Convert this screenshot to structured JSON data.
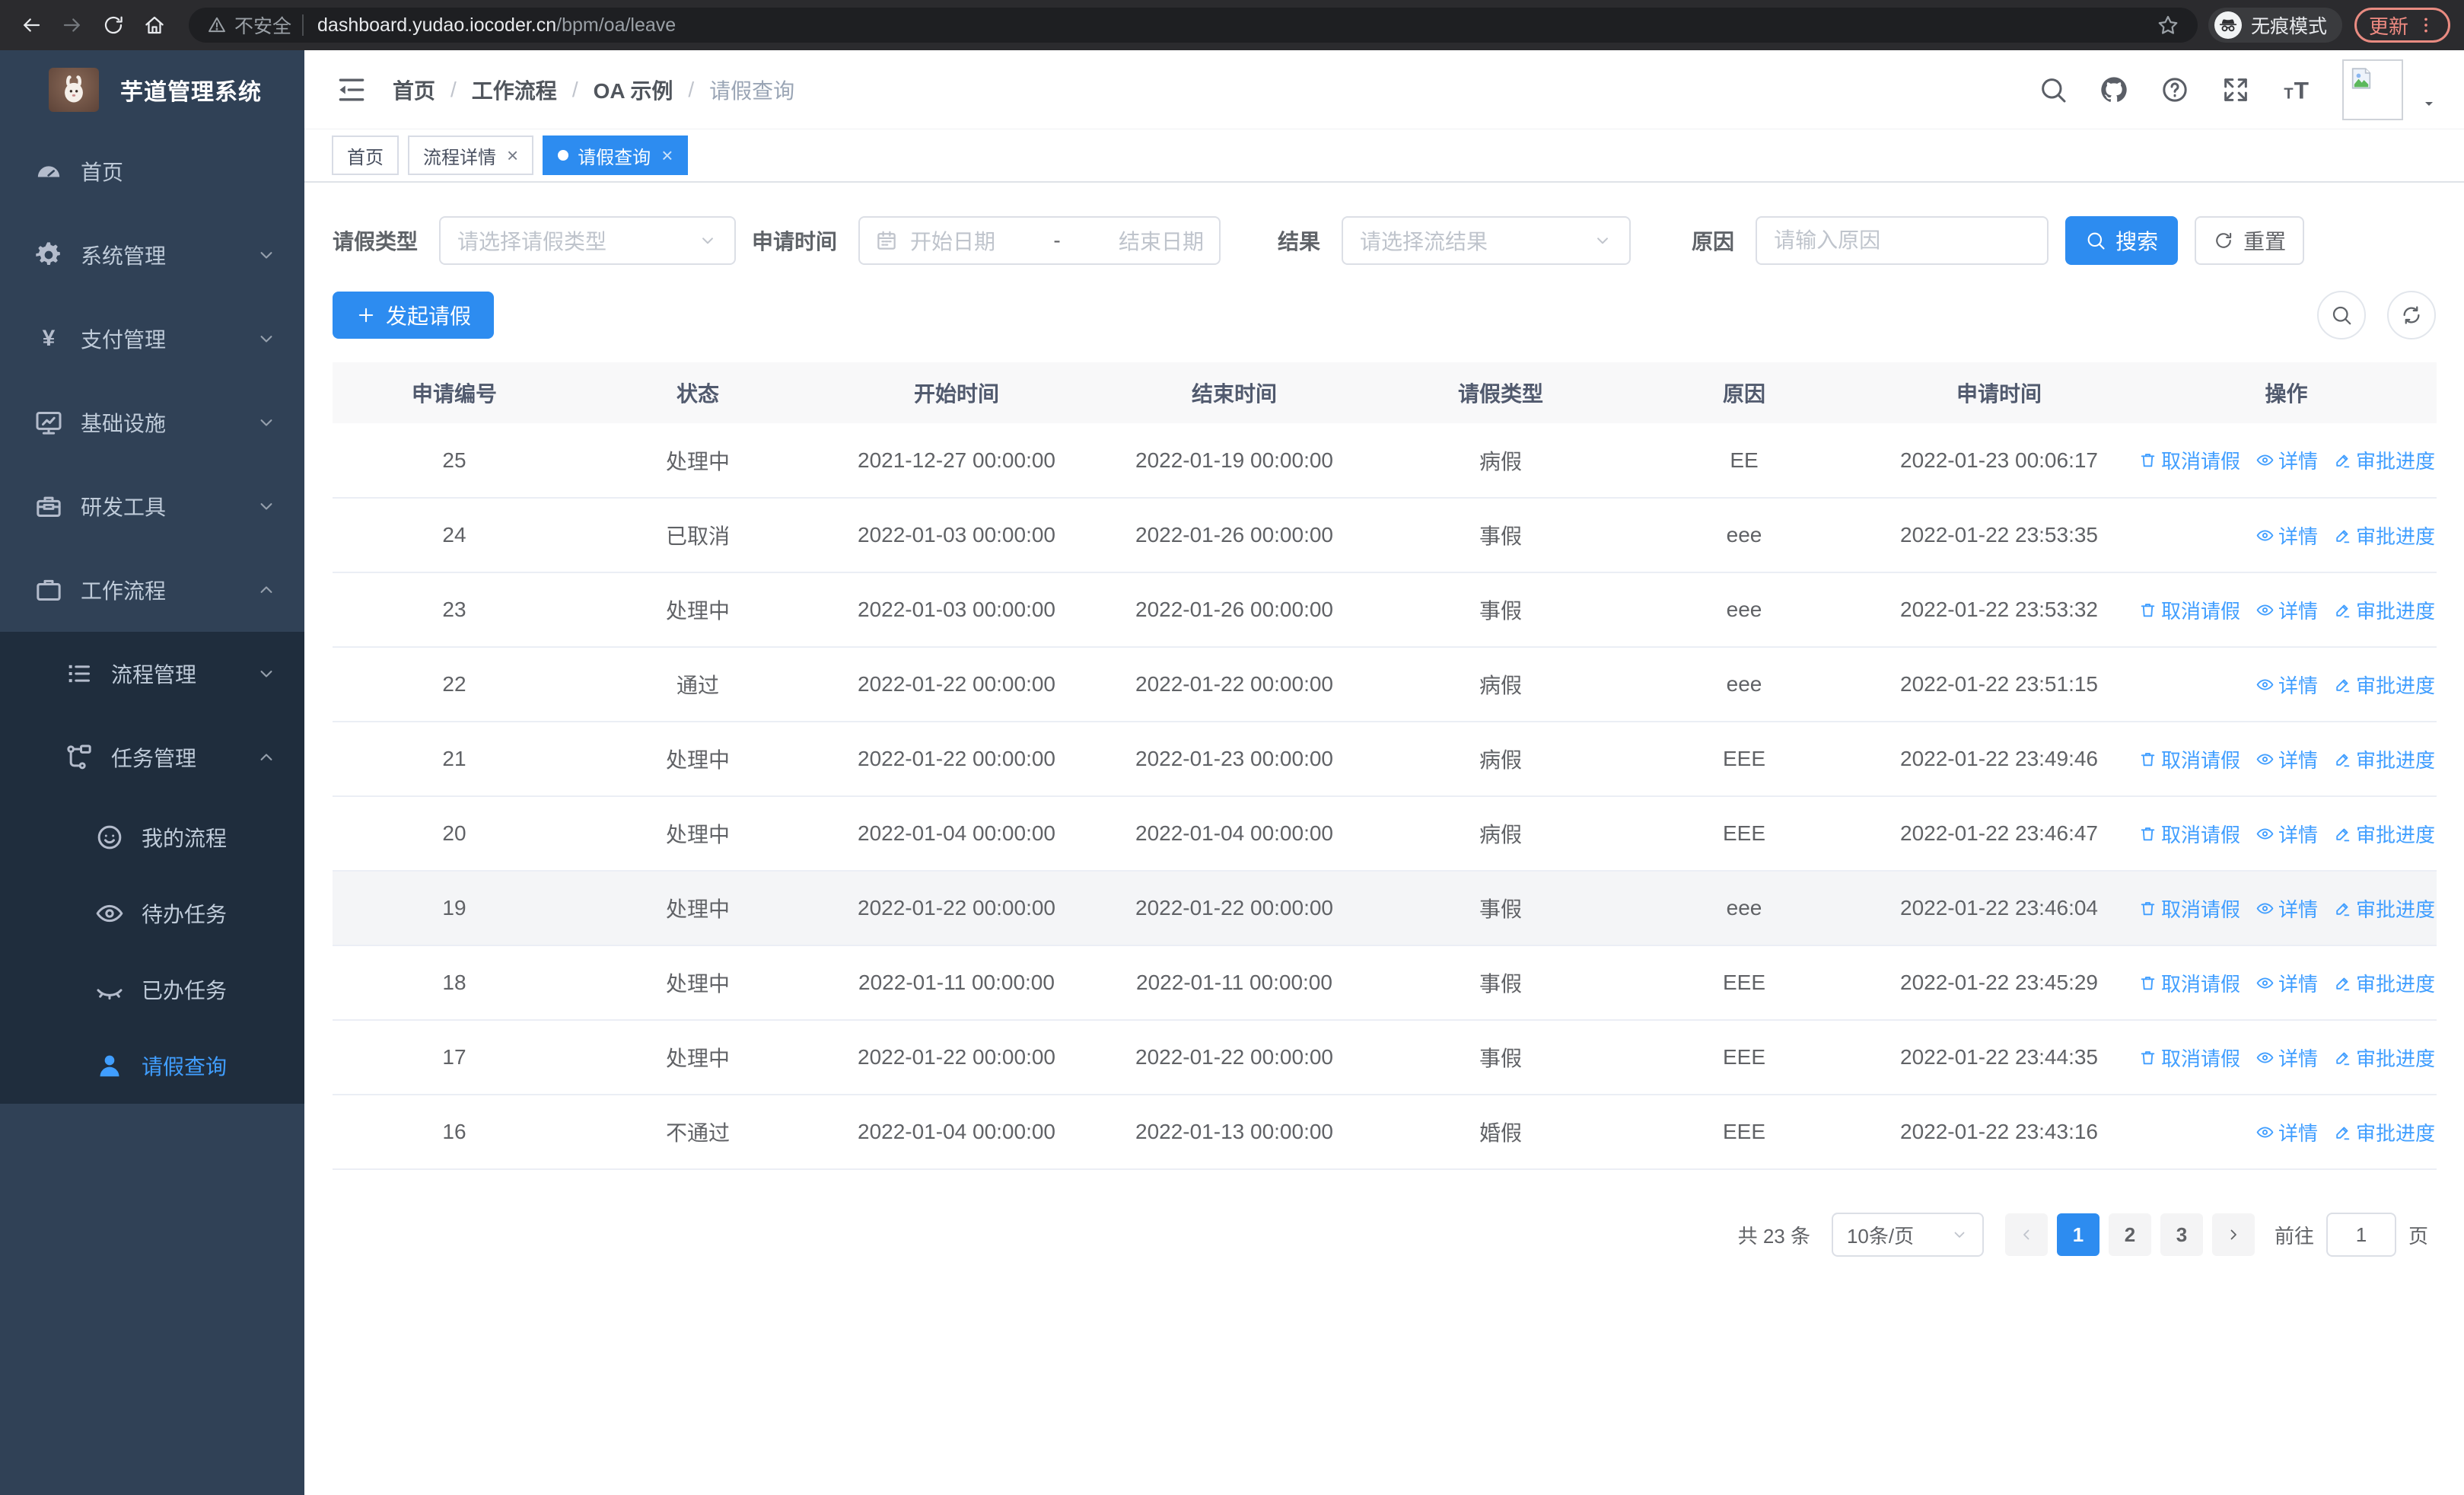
{
  "browser": {
    "security_label": "不安全",
    "url_host": "dashboard.yudao.iocoder.cn",
    "url_path": "/bpm/oa/leave",
    "incognito_label": "无痕模式",
    "update_label": "更新"
  },
  "sidebar": {
    "app_title": "芋道管理系统",
    "menu": [
      {
        "key": "home",
        "icon": "gauge",
        "label": "首页",
        "level": 0
      },
      {
        "key": "system-management",
        "icon": "gear",
        "label": "系统管理",
        "level": 0,
        "chevron": "down"
      },
      {
        "key": "payment-management",
        "icon": "yen",
        "label": "支付管理",
        "level": 0,
        "chevron": "down"
      },
      {
        "key": "infrastructure",
        "icon": "monitor",
        "label": "基础设施",
        "level": 0,
        "chevron": "down"
      },
      {
        "key": "dev-tools",
        "icon": "toolbox",
        "label": "研发工具",
        "level": 0,
        "chevron": "down"
      },
      {
        "key": "workflow",
        "icon": "briefcase",
        "label": "工作流程",
        "level": 0,
        "chevron": "up"
      },
      {
        "key": "process-management",
        "icon": "list",
        "label": "流程管理",
        "level": 1,
        "chevron": "down",
        "sub": true
      },
      {
        "key": "task-management",
        "icon": "flow",
        "label": "任务管理",
        "level": 1,
        "chevron": "up",
        "sub": true
      },
      {
        "key": "my-process",
        "icon": "face",
        "label": "我的流程",
        "level": 2,
        "sub": true
      },
      {
        "key": "todo-tasks",
        "icon": "eye",
        "label": "待办任务",
        "level": 2,
        "sub": true
      },
      {
        "key": "done-tasks",
        "icon": "eyeclosed",
        "label": "已办任务",
        "level": 2,
        "sub": true
      },
      {
        "key": "leave-query",
        "icon": "user",
        "label": "请假查询",
        "level": 2,
        "sub": true,
        "active": true
      }
    ]
  },
  "header": {
    "breadcrumb": [
      "首页",
      "工作流程",
      "OA 示例",
      "请假查询"
    ]
  },
  "tabs": [
    {
      "key": "home",
      "label": "首页",
      "closable": false,
      "active": false
    },
    {
      "key": "process-detail",
      "label": "流程详情",
      "closable": true,
      "active": false
    },
    {
      "key": "leave-query",
      "label": "请假查询",
      "closable": true,
      "active": true
    }
  ],
  "filters": {
    "leave_type": {
      "label": "请假类型",
      "placeholder": "请选择请假类型"
    },
    "apply_time": {
      "label": "申请时间",
      "start_placeholder": "开始日期",
      "separator": "-",
      "end_placeholder": "结束日期"
    },
    "result": {
      "label": "结果",
      "placeholder": "请选择流结果"
    },
    "reason": {
      "label": "原因",
      "placeholder": "请输入原因"
    },
    "search_label": "搜索",
    "reset_label": "重置"
  },
  "toolbar": {
    "create_label": "发起请假"
  },
  "table": {
    "columns": [
      "申请编号",
      "状态",
      "开始时间",
      "结束时间",
      "请假类型",
      "原因",
      "申请时间",
      "操作"
    ],
    "action_labels": {
      "cancel": "取消请假",
      "detail": "详情",
      "progress": "审批进度"
    },
    "rows": [
      {
        "id": "25",
        "status": "处理中",
        "start_time": "2021-12-27 00:00:00",
        "end_time": "2022-01-19 00:00:00",
        "leave_type": "病假",
        "reason": "EE",
        "apply_time": "2022-01-23 00:06:17",
        "actions": [
          "cancel",
          "detail",
          "progress"
        ]
      },
      {
        "id": "24",
        "status": "已取消",
        "start_time": "2022-01-03 00:00:00",
        "end_time": "2022-01-26 00:00:00",
        "leave_type": "事假",
        "reason": "eee",
        "apply_time": "2022-01-22 23:53:35",
        "actions": [
          "detail",
          "progress"
        ]
      },
      {
        "id": "23",
        "status": "处理中",
        "start_time": "2022-01-03 00:00:00",
        "end_time": "2022-01-26 00:00:00",
        "leave_type": "事假",
        "reason": "eee",
        "apply_time": "2022-01-22 23:53:32",
        "actions": [
          "cancel",
          "detail",
          "progress"
        ]
      },
      {
        "id": "22",
        "status": "通过",
        "start_time": "2022-01-22 00:00:00",
        "end_time": "2022-01-22 00:00:00",
        "leave_type": "病假",
        "reason": "eee",
        "apply_time": "2022-01-22 23:51:15",
        "actions": [
          "detail",
          "progress"
        ]
      },
      {
        "id": "21",
        "status": "处理中",
        "start_time": "2022-01-22 00:00:00",
        "end_time": "2022-01-23 00:00:00",
        "leave_type": "病假",
        "reason": "EEE",
        "apply_time": "2022-01-22 23:49:46",
        "actions": [
          "cancel",
          "detail",
          "progress"
        ]
      },
      {
        "id": "20",
        "status": "处理中",
        "start_time": "2022-01-04 00:00:00",
        "end_time": "2022-01-04 00:00:00",
        "leave_type": "病假",
        "reason": "EEE",
        "apply_time": "2022-01-22 23:46:47",
        "actions": [
          "cancel",
          "detail",
          "progress"
        ]
      },
      {
        "id": "19",
        "status": "处理中",
        "start_time": "2022-01-22 00:00:00",
        "end_time": "2022-01-22 00:00:00",
        "leave_type": "事假",
        "reason": "eee",
        "apply_time": "2022-01-22 23:46:04",
        "actions": [
          "cancel",
          "detail",
          "progress"
        ],
        "hover": true
      },
      {
        "id": "18",
        "status": "处理中",
        "start_time": "2022-01-11 00:00:00",
        "end_time": "2022-01-11 00:00:00",
        "leave_type": "事假",
        "reason": "EEE",
        "apply_time": "2022-01-22 23:45:29",
        "actions": [
          "cancel",
          "detail",
          "progress"
        ]
      },
      {
        "id": "17",
        "status": "处理中",
        "start_time": "2022-01-22 00:00:00",
        "end_time": "2022-01-22 00:00:00",
        "leave_type": "事假",
        "reason": "EEE",
        "apply_time": "2022-01-22 23:44:35",
        "actions": [
          "cancel",
          "detail",
          "progress"
        ]
      },
      {
        "id": "16",
        "status": "不通过",
        "start_time": "2022-01-04 00:00:00",
        "end_time": "2022-01-13 00:00:00",
        "leave_type": "婚假",
        "reason": "EEE",
        "apply_time": "2022-01-22 23:43:16",
        "actions": [
          "detail",
          "progress"
        ]
      }
    ]
  },
  "pagination": {
    "total_label": "共 23 条",
    "page_size": "10条/页",
    "pages": [
      "1",
      "2",
      "3"
    ],
    "active_page": "1",
    "goto_label": "前往",
    "goto_value": "1",
    "page_label": "页"
  }
}
